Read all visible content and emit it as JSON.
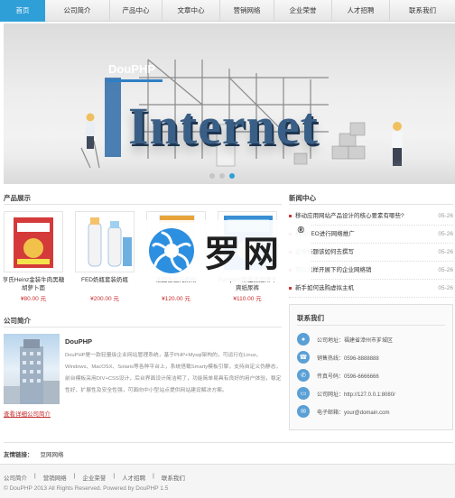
{
  "nav": {
    "items": [
      {
        "label": "首页",
        "active": true
      },
      {
        "label": "公司简介"
      },
      {
        "label": "产品中心"
      },
      {
        "label": "文章中心"
      },
      {
        "label": "营销网络"
      },
      {
        "label": "企业荣誉"
      },
      {
        "label": "人才招聘"
      },
      {
        "label": "联系我们"
      }
    ]
  },
  "banner": {
    "logo_text": "DouPHP",
    "headline": "Internet",
    "slide_count": 3,
    "active_slide": 2
  },
  "products": {
    "title": "产品展示",
    "items": [
      {
        "name": "亨氏Heinz金装牛肉黑糖胡萝卜面",
        "price": "¥80.00 元"
      },
      {
        "name": "FED奶瓶套装奶瓶",
        "price": "¥200.00 元"
      },
      {
        "name": "法国合生元奶粉",
        "price": "¥120.00 元"
      },
      {
        "name": "Pampers帮宝适超薄干爽纸尿裤",
        "price": "¥110.00 元"
      }
    ]
  },
  "news": {
    "title": "新闻中心",
    "items": [
      {
        "title": "移动应用网站产品设计的核心要素有哪些?",
        "date": "05-26"
      },
      {
        "title": "利用SEO进行网络推广",
        "date": "05-26"
      },
      {
        "title": "这些标题该如何去撰写",
        "date": "05-26"
      },
      {
        "title": "可以怎样开展下的企业网络销",
        "date": "05-26"
      },
      {
        "title": "新手如何选购虚拟主机",
        "date": "05-26"
      }
    ]
  },
  "about": {
    "title": "公司简介",
    "company": "DouPHP",
    "text": "DouPHP是一款轻量级企业网站管理系统，基于PHP+Mysql架构的，可运行在Linux、Windows、MacOSX、Solaris等各种平台上，系统搭载Smarty模板引擎，支持自定义伪静态，前台模板采用DIV+CSS设计，后台界面设计简洁明了，功能简单易具有良好的用户体验，稳定性好、扩展性及安全性强，可面向中小型站点提供网站建设解决方案。",
    "more": "查看详细公司简介"
  },
  "contact": {
    "title": "联系我们",
    "rows": [
      {
        "icon": "location-icon",
        "text": "公司地址：福建省漳州市芗城区"
      },
      {
        "icon": "phone-icon",
        "text": "销售热线：0596-8888888"
      },
      {
        "icon": "handset-icon",
        "text": "传真号码：0596-6666666"
      },
      {
        "icon": "web-icon",
        "text": "公司网址：http://127.0.0.1:8080/"
      },
      {
        "icon": "mail-icon",
        "text": "电子邮箱：your@domain.com"
      }
    ]
  },
  "links": {
    "label": "友情链接：",
    "items": [
      "豆网网络"
    ]
  },
  "footer": {
    "links": [
      "公司简介",
      "营销网络",
      "企业荣誉",
      "人才招聘",
      "联系我们"
    ],
    "copyright": "© DouPHP 2013 All Rights Reserved. Powered by DouPHP 1.5"
  },
  "watermark": {
    "text": "罗网",
    "reg": "®"
  },
  "colors": {
    "accent": "#2f9fd8",
    "price": "#c62d2d"
  }
}
